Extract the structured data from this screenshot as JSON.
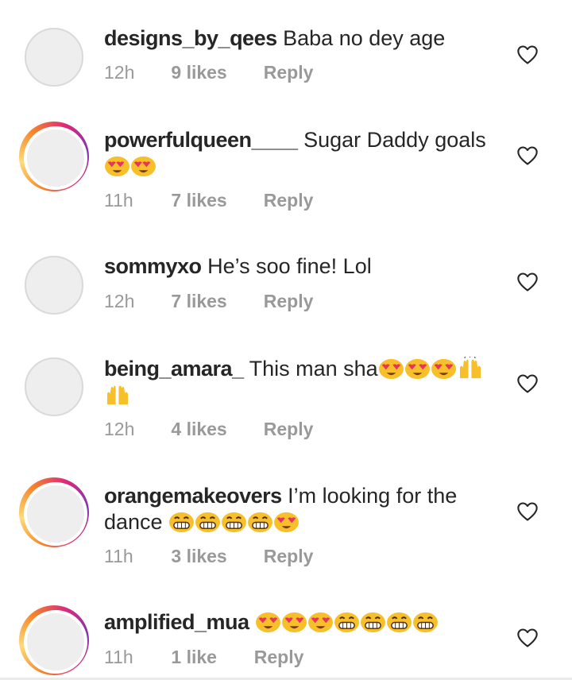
{
  "comments": [
    {
      "username": "designs_by_qees",
      "text": "Baba no dey age",
      "time": "12h",
      "likes": "9 likes",
      "reply": "Reply",
      "emojis": []
    },
    {
      "username": "powerfulqueen____",
      "text": "Sugar Daddy goals",
      "time": "11h",
      "likes": "7 likes",
      "reply": "Reply",
      "emojis": [
        "heart-eyes-emoji",
        "heart-eyes-emoji"
      ]
    },
    {
      "username": "sommyxo",
      "text": "He’s soo fine! Lol",
      "time": "12h",
      "likes": "7 likes",
      "reply": "Reply",
      "emojis": []
    },
    {
      "username": "being_amara_",
      "text": "This man sha",
      "time": "12h",
      "likes": "4 likes",
      "reply": "Reply",
      "emojis": [
        "heart-eyes-emoji",
        "heart-eyes-emoji",
        "heart-eyes-emoji",
        "raised-hands-emoji",
        "raised-hands-emoji"
      ]
    },
    {
      "username": "orangemakeovers",
      "text": "I’m looking for the dance",
      "time": "11h",
      "likes": "3 likes",
      "reply": "Reply",
      "emojis": [
        "grinning-emoji",
        "grinning-emoji",
        "grinning-emoji",
        "grinning-emoji",
        "heart-eyes-emoji"
      ]
    },
    {
      "username": "amplified_mua",
      "text": "",
      "time": "11h",
      "likes": "1 like",
      "reply": "Reply",
      "emojis": [
        "heart-eyes-emoji",
        "heart-eyes-emoji",
        "heart-eyes-emoji",
        "grinning-emoji",
        "grinning-emoji",
        "grinning-emoji",
        "grinning-emoji"
      ]
    }
  ],
  "icons": {
    "like": "heart-outline-icon"
  },
  "colors": {
    "text": "#262626",
    "meta": "#999999",
    "emoji": "#f7c02b",
    "heart_eyes": "#e8345a"
  }
}
